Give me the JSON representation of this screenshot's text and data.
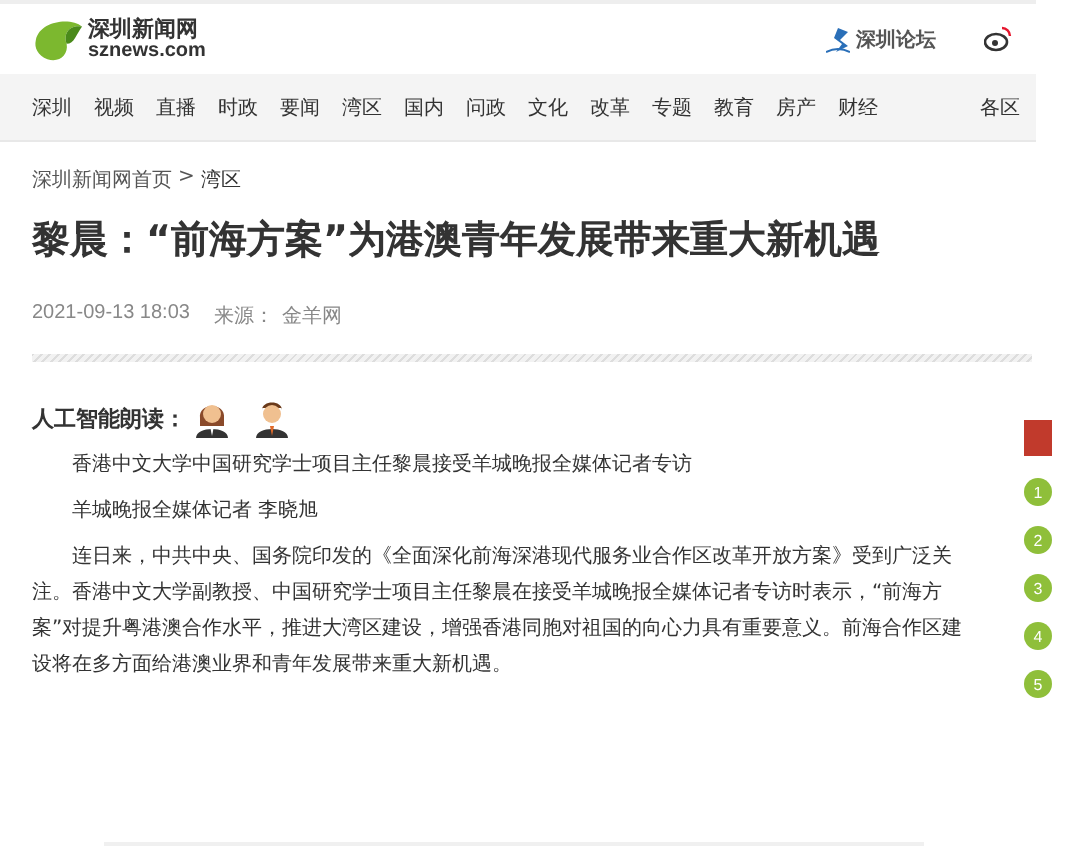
{
  "header": {
    "logo_name": "深圳新闻网",
    "logo_domain": "sznews.com",
    "forum": "深圳论坛"
  },
  "nav": [
    {
      "label": "深圳"
    },
    {
      "label": "视频"
    },
    {
      "label": "直播"
    },
    {
      "label": "时政"
    },
    {
      "label": "要闻"
    },
    {
      "label": "湾区"
    },
    {
      "label": "国内"
    },
    {
      "label": "问政"
    },
    {
      "label": "文化"
    },
    {
      "label": "改革"
    },
    {
      "label": "专题"
    },
    {
      "label": "教育"
    },
    {
      "label": "房产"
    },
    {
      "label": "财经"
    },
    {
      "label": "各区"
    }
  ],
  "breadcrumb": {
    "home": "深圳新闻网首页",
    "separator": ">",
    "current": "湾区"
  },
  "article": {
    "title": "黎晨：“前海方案”为港澳青年发展带来重大新机遇",
    "date": "2021-09-13 18:03",
    "source_label": "来源：",
    "source": "金羊网",
    "ai_reading": "人工智能朗读：",
    "paragraphs": [
      "香港中文大学中国研究学士项目主任黎晨接受羊城晚报全媒体记者专访",
      "羊城晚报全媒体记者 李晓旭",
      "连日来，中共中央、国务院印发的《全面深化前海深港现代服务业合作区改革开放方案》受到广泛关注。香港中文大学副教授、中国研究学士项目主任黎晨在接受羊城晚报全媒体记者专访时表示，“前海方案”对提升粤港澳合作水平，推进大湾区建设，增强香港同胞对祖国的向心力具有重要意义。前海合作区建设将在多方面给港澳业界和青年发展带来重大新机遇。"
    ]
  },
  "side_numbers": [
    "1",
    "2",
    "3",
    "4",
    "5"
  ]
}
